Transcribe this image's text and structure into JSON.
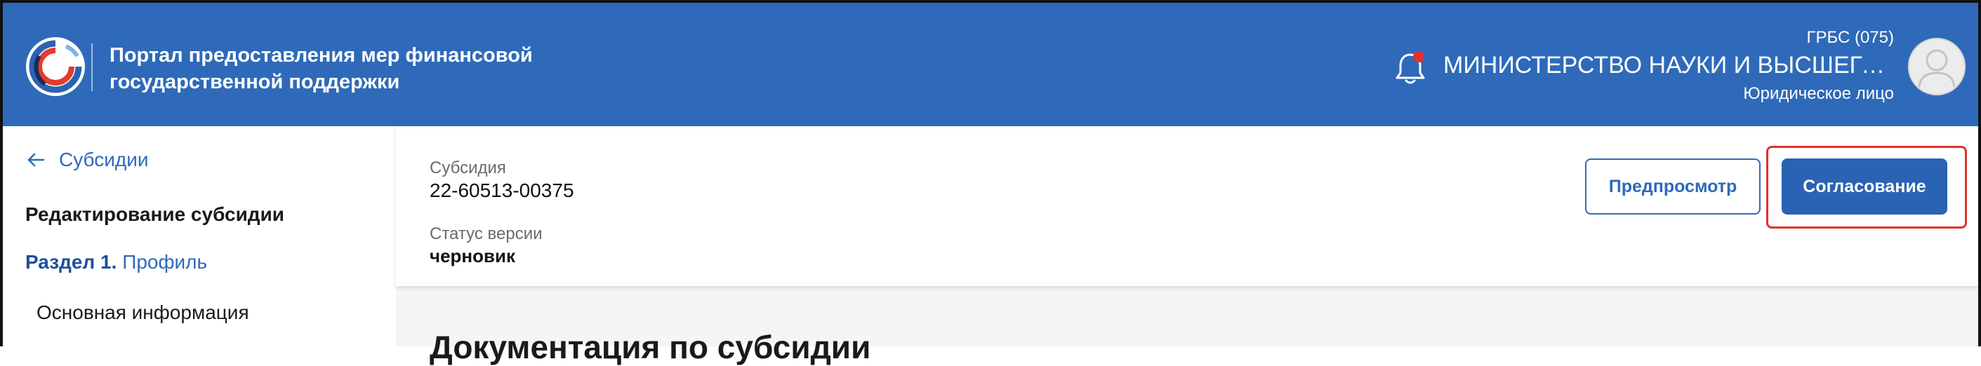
{
  "header": {
    "portal_title_line1": "Портал предоставления мер финансовой",
    "portal_title_line2": "государственной поддержки",
    "org_code": "ГРБС (075)",
    "org_name": "МИНИСТЕРСТВО НАУКИ И ВЫСШЕГО...",
    "org_type": "Юридическое лицо",
    "header_color": "#2e6ab9",
    "notification_dot_color": "#e0322b"
  },
  "sidebar": {
    "back_label": "Субсидии",
    "heading": "Редактирование субсидии",
    "section_prefix": "Раздел 1.",
    "section_name": "Профиль",
    "items": [
      {
        "label": "Основная информация"
      }
    ]
  },
  "subsidy": {
    "id_label": "Субсидия",
    "id_value": "22-60513-00375",
    "status_label": "Статус версии",
    "status_value": "черновик"
  },
  "actions": {
    "preview_label": "Предпросмотр",
    "approve_label": "Согласование",
    "highlight_color": "#e0322b"
  },
  "main": {
    "doc_heading": "Документация по субсидии"
  }
}
